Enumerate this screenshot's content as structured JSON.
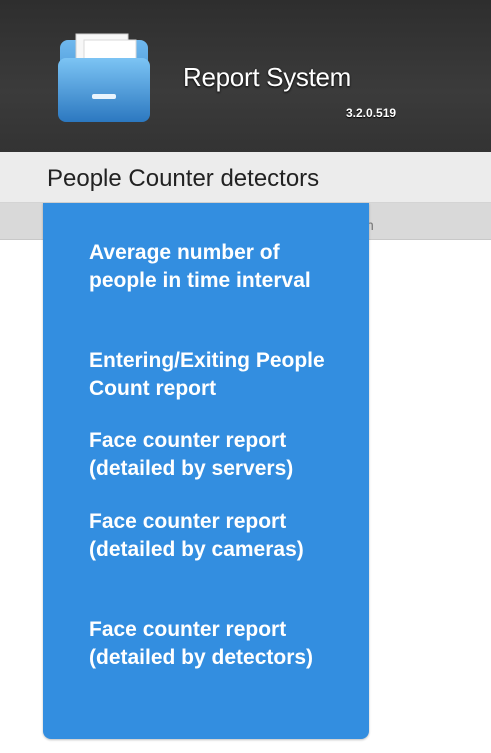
{
  "app": {
    "title": "Report System",
    "version": "3.2.0.519",
    "icon": "folder-icon"
  },
  "menu": {
    "current": "People Counter detectors",
    "items": [
      "Average number of people in time interval",
      "Entering/Exiting People Count report",
      "Face counter report (detailed by servers)",
      "Face counter report (detailed by cameras)",
      "Face counter report (detailed by detectors)"
    ]
  },
  "subbar": {
    "fragment": "n"
  },
  "colors": {
    "header_bg": "#333333",
    "menubar_bg": "#ececec",
    "dropdown_bg": "#338ee0",
    "text_on_accent": "#ffffff"
  }
}
